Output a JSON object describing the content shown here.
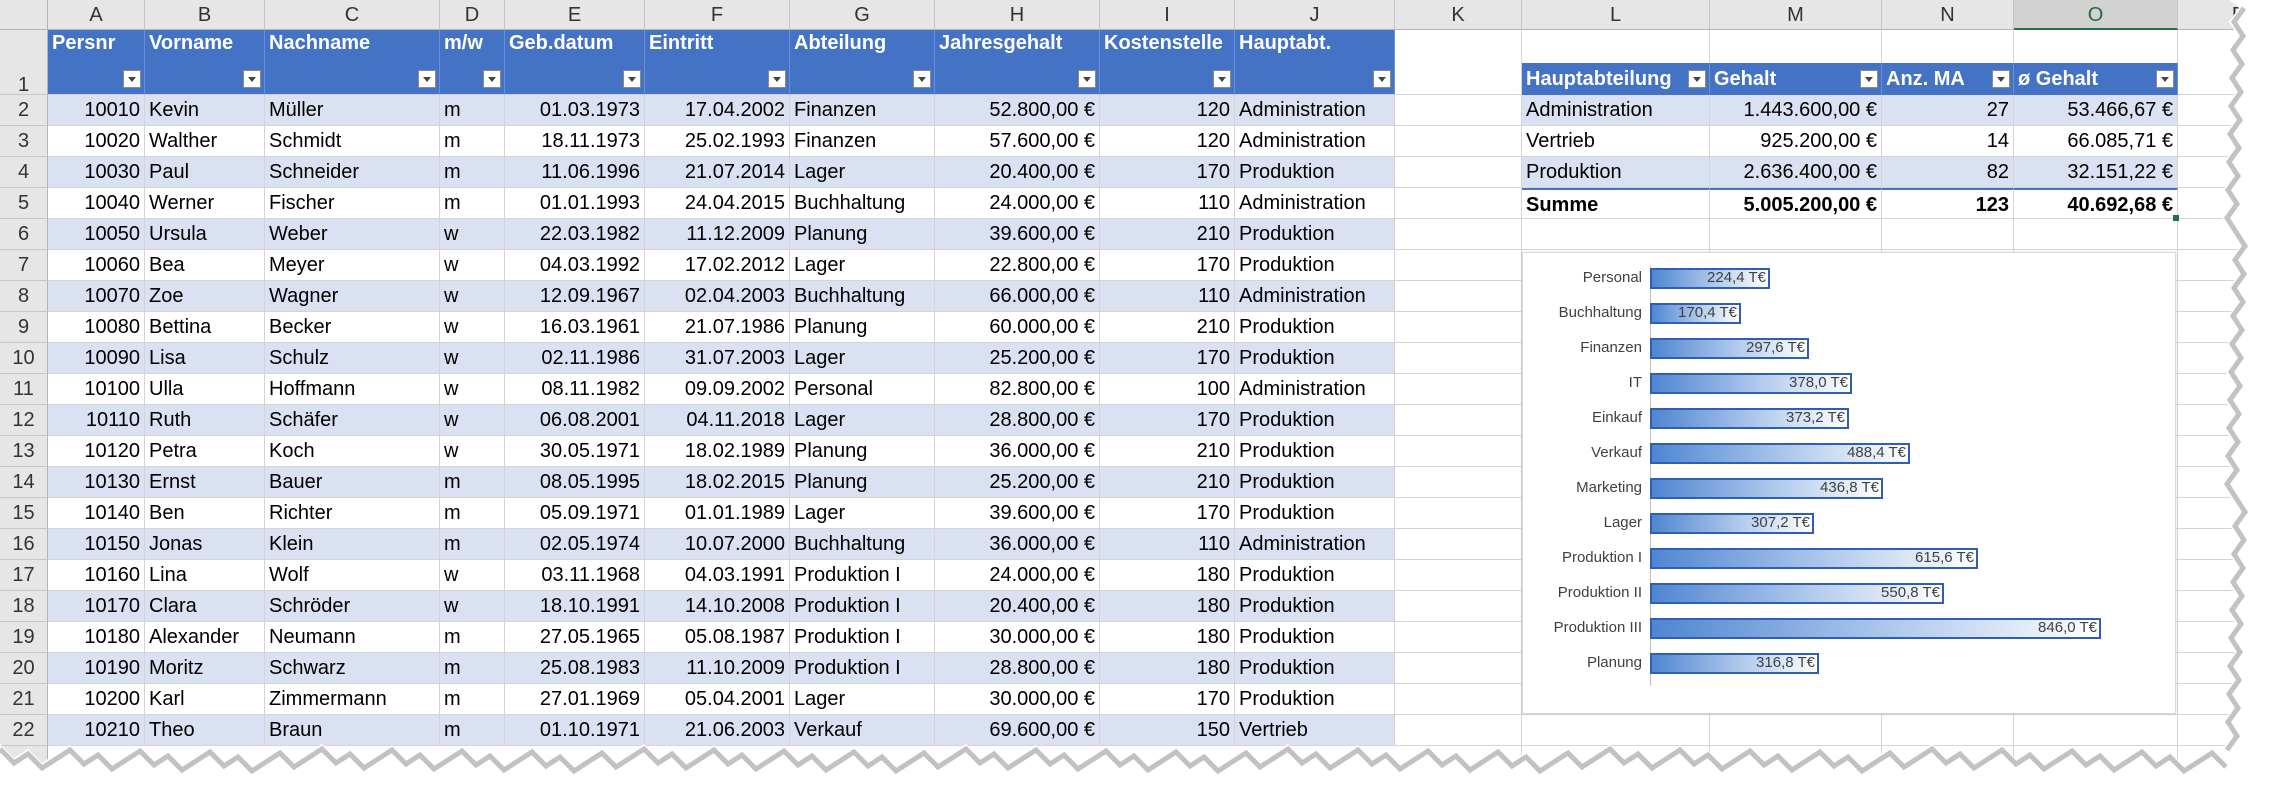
{
  "columns": [
    "A",
    "B",
    "C",
    "D",
    "E",
    "F",
    "G",
    "H",
    "I",
    "J",
    "K",
    "L",
    "M",
    "N",
    "O",
    "P"
  ],
  "selected_column": "O",
  "row_numbers": [
    "1",
    "2",
    "3",
    "4",
    "5",
    "6",
    "7",
    "8",
    "9",
    "10",
    "11",
    "12",
    "13",
    "14",
    "15",
    "16",
    "17",
    "18",
    "19",
    "20",
    "21",
    "22"
  ],
  "main_table": {
    "headers": [
      "Persnr",
      "Vorname",
      "Nachname",
      "m/w",
      "Geb.datum",
      "Eintritt",
      "Abteilung",
      "Jahresgehalt",
      "Kostenstelle",
      "Hauptabt."
    ],
    "rows": [
      [
        "10010",
        "Kevin",
        "Müller",
        "m",
        "01.03.1973",
        "17.04.2002",
        "Finanzen",
        "52.800,00 €",
        "120",
        "Administration"
      ],
      [
        "10020",
        "Walther",
        "Schmidt",
        "m",
        "18.11.1973",
        "25.02.1993",
        "Finanzen",
        "57.600,00 €",
        "120",
        "Administration"
      ],
      [
        "10030",
        "Paul",
        "Schneider",
        "m",
        "11.06.1996",
        "21.07.2014",
        "Lager",
        "20.400,00 €",
        "170",
        "Produktion"
      ],
      [
        "10040",
        "Werner",
        "Fischer",
        "m",
        "01.01.1993",
        "24.04.2015",
        "Buchhaltung",
        "24.000,00 €",
        "110",
        "Administration"
      ],
      [
        "10050",
        "Ursula",
        "Weber",
        "w",
        "22.03.1982",
        "11.12.2009",
        "Planung",
        "39.600,00 €",
        "210",
        "Produktion"
      ],
      [
        "10060",
        "Bea",
        "Meyer",
        "w",
        "04.03.1992",
        "17.02.2012",
        "Lager",
        "22.800,00 €",
        "170",
        "Produktion"
      ],
      [
        "10070",
        "Zoe",
        "Wagner",
        "w",
        "12.09.1967",
        "02.04.2003",
        "Buchhaltung",
        "66.000,00 €",
        "110",
        "Administration"
      ],
      [
        "10080",
        "Bettina",
        "Becker",
        "w",
        "16.03.1961",
        "21.07.1986",
        "Planung",
        "60.000,00 €",
        "210",
        "Produktion"
      ],
      [
        "10090",
        "Lisa",
        "Schulz",
        "w",
        "02.11.1986",
        "31.07.2003",
        "Lager",
        "25.200,00 €",
        "170",
        "Produktion"
      ],
      [
        "10100",
        "Ulla",
        "Hoffmann",
        "w",
        "08.11.1982",
        "09.09.2002",
        "Personal",
        "82.800,00 €",
        "100",
        "Administration"
      ],
      [
        "10110",
        "Ruth",
        "Schäfer",
        "w",
        "06.08.2001",
        "04.11.2018",
        "Lager",
        "28.800,00 €",
        "170",
        "Produktion"
      ],
      [
        "10120",
        "Petra",
        "Koch",
        "w",
        "30.05.1971",
        "18.02.1989",
        "Planung",
        "36.000,00 €",
        "210",
        "Produktion"
      ],
      [
        "10130",
        "Ernst",
        "Bauer",
        "m",
        "08.05.1995",
        "18.02.2015",
        "Planung",
        "25.200,00 €",
        "210",
        "Produktion"
      ],
      [
        "10140",
        "Ben",
        "Richter",
        "m",
        "05.09.1971",
        "01.01.1989",
        "Lager",
        "39.600,00 €",
        "170",
        "Produktion"
      ],
      [
        "10150",
        "Jonas",
        "Klein",
        "m",
        "02.05.1974",
        "10.07.2000",
        "Buchhaltung",
        "36.000,00 €",
        "110",
        "Administration"
      ],
      [
        "10160",
        "Lina",
        "Wolf",
        "w",
        "03.11.1968",
        "04.03.1991",
        "Produktion I",
        "24.000,00 €",
        "180",
        "Produktion"
      ],
      [
        "10170",
        "Clara",
        "Schröder",
        "w",
        "18.10.1991",
        "14.10.2008",
        "Produktion I",
        "20.400,00 €",
        "180",
        "Produktion"
      ],
      [
        "10180",
        "Alexander",
        "Neumann",
        "m",
        "27.05.1965",
        "05.08.1987",
        "Produktion I",
        "30.000,00 €",
        "180",
        "Produktion"
      ],
      [
        "10190",
        "Moritz",
        "Schwarz",
        "m",
        "25.08.1983",
        "11.10.2009",
        "Produktion I",
        "28.800,00 €",
        "180",
        "Produktion"
      ],
      [
        "10200",
        "Karl",
        "Zimmermann",
        "m",
        "27.01.1969",
        "05.04.2001",
        "Lager",
        "30.000,00 €",
        "170",
        "Produktion"
      ],
      [
        "10210",
        "Theo",
        "Braun",
        "m",
        "01.10.1971",
        "21.06.2003",
        "Verkauf",
        "69.600,00 €",
        "150",
        "Vertrieb"
      ]
    ]
  },
  "summary_table": {
    "headers": [
      "Hauptabteilung",
      "Gehalt",
      "Anz. MA",
      "ø Gehalt"
    ],
    "rows": [
      [
        "Administration",
        "1.443.600,00 €",
        "27",
        "53.466,67 €"
      ],
      [
        "Vertrieb",
        "925.200,00 €",
        "14",
        "66.085,71 €"
      ],
      [
        "Produktion",
        "2.636.400,00 €",
        "82",
        "32.151,22 €"
      ]
    ],
    "total": [
      "Summe",
      "5.005.200,00 €",
      "123",
      "40.692,68 €"
    ]
  },
  "chart_data": {
    "type": "bar",
    "orientation": "horizontal",
    "categories": [
      "Personal",
      "Buchhaltung",
      "Finanzen",
      "IT",
      "Einkauf",
      "Verkauf",
      "Marketing",
      "Lager",
      "Produktion I",
      "Produktion II",
      "Produktion III",
      "Planung"
    ],
    "values": [
      224.4,
      170.4,
      297.6,
      378.0,
      373.2,
      488.4,
      436.8,
      307.2,
      615.6,
      550.8,
      846.0,
      316.8
    ],
    "labels": [
      "224,4 T€",
      "170,4 T€",
      "297,6 T€",
      "378,0 T€",
      "373,2 T€",
      "488,4 T€",
      "436,8 T€",
      "307,2 T€",
      "615,6 T€",
      "550,8 T€",
      "846,0 T€",
      "316,8 T€"
    ],
    "xlim": [
      0,
      900
    ],
    "grid": false,
    "legend": "none"
  },
  "colors": {
    "header_blue": "#4472c4",
    "band_blue": "#d9e1f2",
    "bar_border": "#2e5fb4"
  }
}
